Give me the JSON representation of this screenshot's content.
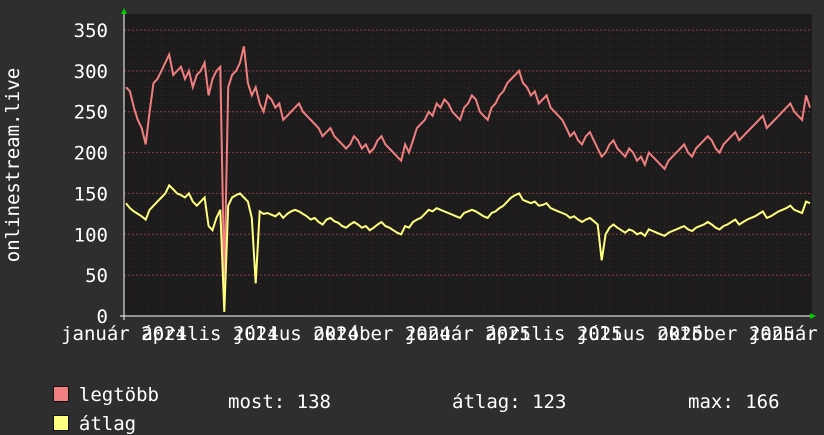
{
  "colors": {
    "background": "#2e2e2e",
    "plot_bg": "#1c1c1c",
    "grid": "#a04040",
    "axis": "#ffffff",
    "max_series": "#f08080",
    "avg_series": "#ffff80",
    "arrow": "#00cc00"
  },
  "chart_data": {
    "type": "line",
    "ylabel": "onlinestream.live",
    "ylim": [
      0,
      350
    ],
    "yticks": [
      0,
      50,
      100,
      150,
      200,
      250,
      300,
      350
    ],
    "xtick_labels": [
      "január 2024",
      "április 2024",
      "július 2024",
      "október 2024",
      "január 2025",
      "április 2025",
      "július 2025",
      "október 2025",
      "január 2026"
    ],
    "grid": true,
    "series": [
      {
        "name": "legtöbb",
        "values": [
          280,
          275,
          255,
          240,
          230,
          210,
          250,
          285,
          290,
          300,
          310,
          320,
          295,
          300,
          305,
          290,
          300,
          280,
          295,
          300,
          310,
          270,
          290,
          300,
          305,
          40,
          280,
          295,
          300,
          310,
          330,
          285,
          270,
          280,
          260,
          250,
          270,
          265,
          255,
          260,
          240,
          245,
          250,
          255,
          260,
          250,
          245,
          240,
          235,
          230,
          220,
          225,
          230,
          220,
          215,
          210,
          205,
          210,
          220,
          215,
          205,
          210,
          200,
          205,
          215,
          220,
          210,
          205,
          200,
          195,
          190,
          210,
          200,
          215,
          230,
          235,
          240,
          250,
          245,
          260,
          255,
          265,
          260,
          250,
          245,
          240,
          255,
          260,
          270,
          265,
          250,
          245,
          240,
          255,
          260,
          270,
          275,
          285,
          290,
          295,
          300,
          285,
          280,
          270,
          275,
          260,
          265,
          270,
          255,
          250,
          245,
          240,
          230,
          220,
          225,
          215,
          210,
          220,
          225,
          215,
          205,
          195,
          200,
          210,
          215,
          205,
          200,
          195,
          205,
          200,
          190,
          195,
          185,
          200,
          195,
          190,
          185,
          180,
          190,
          195,
          200,
          205,
          210,
          200,
          195,
          205,
          210,
          215,
          220,
          215,
          205,
          200,
          210,
          215,
          220,
          225,
          215,
          220,
          225,
          230,
          235,
          240,
          245,
          230,
          235,
          240,
          245,
          250,
          255,
          260,
          250,
          245,
          240,
          270,
          255
        ],
        "avg_values": []
      },
      {
        "name": "átlag",
        "values": [
          138,
          132,
          128,
          125,
          122,
          118,
          130,
          135,
          140,
          145,
          150,
          160,
          155,
          150,
          148,
          145,
          150,
          140,
          135,
          140,
          145,
          110,
          105,
          120,
          130,
          5,
          135,
          145,
          148,
          150,
          145,
          140,
          120,
          40,
          128,
          125,
          126,
          124,
          122,
          126,
          120,
          125,
          128,
          130,
          128,
          125,
          122,
          118,
          120,
          115,
          112,
          118,
          120,
          116,
          114,
          110,
          108,
          112,
          115,
          112,
          108,
          110,
          105,
          108,
          112,
          115,
          110,
          108,
          105,
          102,
          100,
          110,
          108,
          115,
          118,
          120,
          125,
          130,
          128,
          132,
          130,
          128,
          126,
          124,
          122,
          120,
          126,
          128,
          130,
          128,
          125,
          122,
          120,
          126,
          128,
          132,
          135,
          140,
          145,
          148,
          150,
          142,
          140,
          138,
          140,
          135,
          136,
          138,
          132,
          130,
          128,
          126,
          124,
          120,
          122,
          118,
          115,
          118,
          120,
          116,
          112,
          68,
          100,
          108,
          112,
          108,
          105,
          102,
          106,
          104,
          100,
          102,
          98,
          106,
          104,
          102,
          100,
          98,
          102,
          104,
          106,
          108,
          110,
          106,
          104,
          108,
          110,
          112,
          115,
          112,
          108,
          106,
          110,
          112,
          115,
          118,
          112,
          115,
          118,
          120,
          122,
          125,
          128,
          120,
          122,
          125,
          128,
          130,
          132,
          135,
          130,
          128,
          126,
          140,
          138
        ]
      }
    ],
    "legend": [
      {
        "label": "legtöbb"
      },
      {
        "label": "átlag"
      }
    ],
    "stats": {
      "most": "most: 138",
      "atlag": "átlag: 123",
      "max": "max: 166"
    }
  }
}
